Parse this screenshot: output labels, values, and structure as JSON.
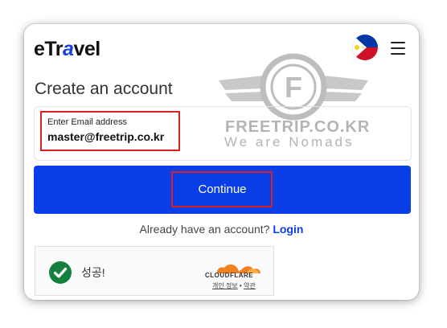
{
  "header": {
    "logo_prefix": "eTr",
    "logo_accent": "a",
    "logo_suffix": "vel",
    "flag_icon": "philippines-flag-icon",
    "menu_icon": "hamburger-menu-icon"
  },
  "watermark": {
    "line1": "FREETRIP.CO.KR",
    "line2": "We are Nomads",
    "emblem_letter": "F"
  },
  "form": {
    "title": "Create an account",
    "email_label": "Enter Email address",
    "email_value": "master@freetrip.co.kr",
    "continue_label": "Continue",
    "already_text": "Already have an account?",
    "login_label": "Login"
  },
  "cloudflare": {
    "status": "성공!",
    "brand": "CLOUDFLARE",
    "privacy_link": "개인 정보",
    "separator": "•",
    "terms_link": "약관"
  },
  "colors": {
    "primary": "#0a3fe8",
    "highlight": "#d82020",
    "success": "#15803d",
    "cloudflare_orange": "#f38020"
  }
}
